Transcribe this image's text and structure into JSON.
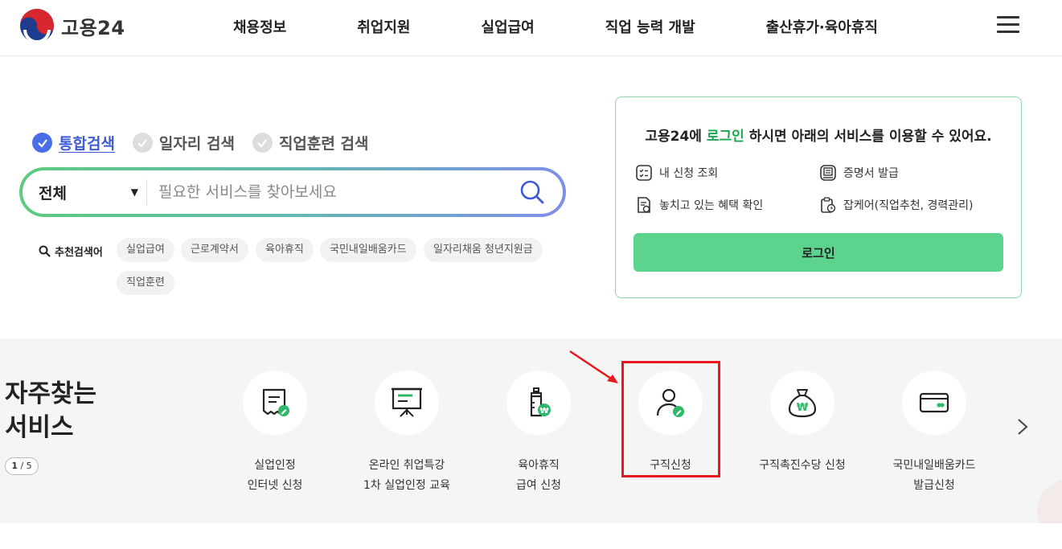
{
  "header": {
    "logo_text": "고용24",
    "nav": [
      "채용정보",
      "취업지원",
      "실업급여",
      "직업 능력 개발",
      "출산휴가·육아휴직"
    ]
  },
  "search": {
    "tabs": [
      {
        "label": "통합검색",
        "active": true
      },
      {
        "label": "일자리 검색",
        "active": false
      },
      {
        "label": "직업훈련 검색",
        "active": false
      }
    ],
    "category": "전체",
    "placeholder": "필요한 서비스를 찾아보세요",
    "recommended_title": "추천검색어",
    "keywords": [
      "실업급여",
      "근로계약서",
      "육아휴직",
      "국민내일배움카드",
      "일자리채움 청년지원금",
      "직업훈련"
    ]
  },
  "login_card": {
    "message_prefix": "고용24에 ",
    "message_highlight": "로그인",
    "message_suffix": " 하시면 아래의 서비스를 이용할 수 있어요.",
    "services": [
      "내 신청 조회",
      "증명서 발급",
      "놓치고 있는 혜택 확인",
      "잡케어(직업추천, 경력관리)"
    ],
    "button_label": "로그인"
  },
  "frequent": {
    "title_line1": "자주찾는",
    "title_line2": "서비스",
    "page_current": "1",
    "page_sep": " / ",
    "page_total": "5",
    "items": [
      {
        "label": "실업인정\n인터넷 신청",
        "icon": "receipt-edit-icon"
      },
      {
        "label": "온라인 취업특강\n1차 실업인정 교육",
        "icon": "presentation-board-icon"
      },
      {
        "label": "육아휴직\n급여 신청",
        "icon": "baby-bottle-icon"
      },
      {
        "label": "구직신청",
        "icon": "person-edit-icon"
      },
      {
        "label": "구직촉진수당 신청",
        "icon": "money-bag-icon"
      },
      {
        "label": "국민내일배움카드\n발급신청",
        "icon": "card-icon"
      }
    ]
  },
  "colors": {
    "accent_green": "#5cd48d",
    "accent_blue": "#4a6de5",
    "annotation_red": "#e8161d"
  }
}
